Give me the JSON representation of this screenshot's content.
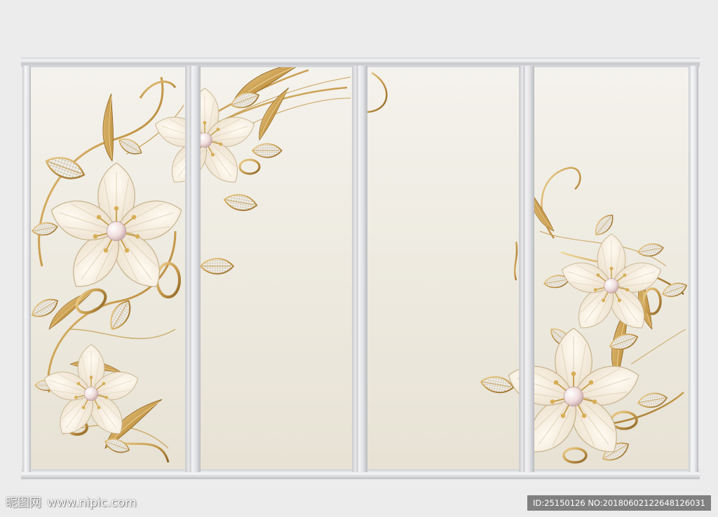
{
  "scene": {
    "description_free": true,
    "colors": {
      "wall": "#ececec",
      "frame": "#dfe0e3",
      "panel_top": "#f3f0e9",
      "panel_bottom": "#e6e1d3",
      "gold": "#c9a25a",
      "gold_dark": "#9c7630",
      "petal": "#f4ece0",
      "pearl": "#f3e6e6"
    },
    "panels": 4
  },
  "watermark": {
    "site_cn": "昵图网",
    "site_url": "www.nipic.com",
    "id_text": "ID:25150126 NO:20180602122648126031"
  }
}
